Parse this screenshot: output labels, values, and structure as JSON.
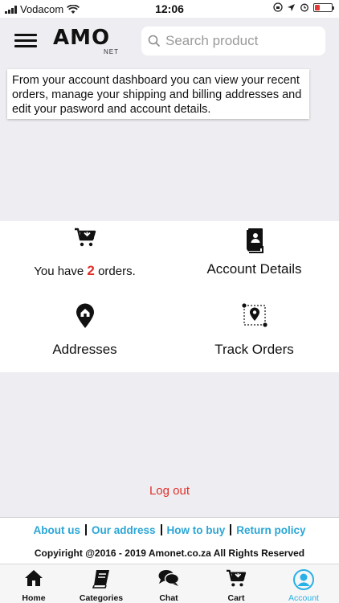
{
  "status_bar": {
    "carrier": "Vodacom",
    "time": "12:06"
  },
  "header": {
    "logo_text": "AMO",
    "logo_sub": "NET",
    "search_placeholder": "Search product"
  },
  "info_text": "From your account dashboard you can view your recent orders, manage your shipping and billing addresses and edit your pasword and account details.",
  "dashboard": {
    "orders_prefix": "You have",
    "orders_count": "2",
    "orders_suffix": "orders.",
    "account_details": "Account Details",
    "addresses": "Addresses",
    "track_orders": "Track Orders"
  },
  "logout_label": "Log out",
  "footer": {
    "links": [
      "About us",
      "Our address",
      "How to buy",
      "Return policy"
    ],
    "copyright": "Copyiright @2016 - 2019 Amonet.co.za All Rights Reserved"
  },
  "tabs": [
    {
      "label": "Home",
      "icon": "home-icon"
    },
    {
      "label": "Categories",
      "icon": "book-icon"
    },
    {
      "label": "Chat",
      "icon": "chat-icon"
    },
    {
      "label": "Cart",
      "icon": "cart-icon"
    },
    {
      "label": "Account",
      "icon": "account-icon"
    }
  ],
  "colors": {
    "accent": "#29b0e6",
    "danger": "#e0302a",
    "background": "#eeeef2"
  }
}
